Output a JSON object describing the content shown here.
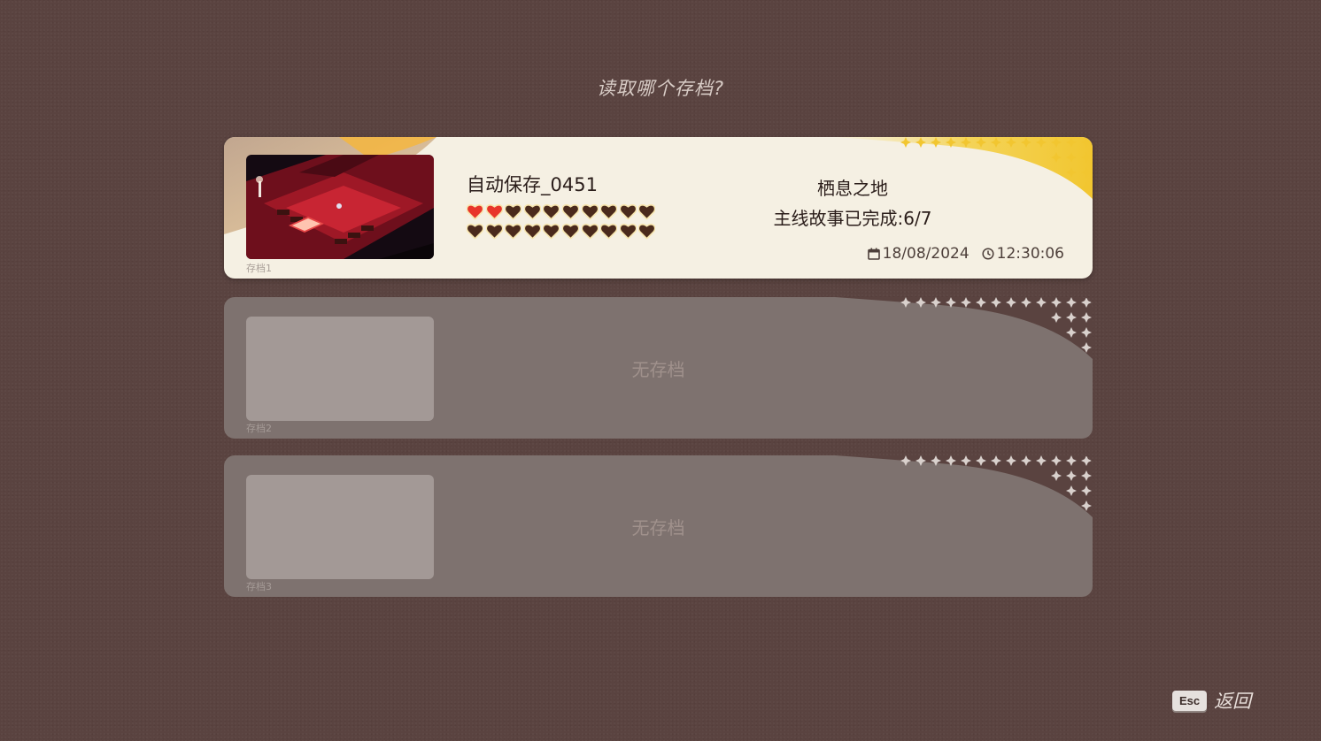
{
  "title": "读取哪个存档?",
  "slots": [
    {
      "label": "存档1",
      "filled": true,
      "save_name": "自动保存_0451",
      "hearts_filled": 2,
      "hearts_total": 20,
      "location": "栖息之地",
      "progress": "主线故事已完成:6/7",
      "date": "18/08/2024",
      "time": "12:30:06"
    },
    {
      "label": "存档2",
      "filled": false,
      "empty_text": "无存档"
    },
    {
      "label": "存档3",
      "filled": false,
      "empty_text": "无存档"
    }
  ],
  "footer": {
    "key": "Esc",
    "action": "返回"
  },
  "colors": {
    "background": "#5a4340",
    "card_filled": "#f5f0e3",
    "card_empty": "#7e726f",
    "heart_full": "#e8352a",
    "heart_empty": "#4a2a1c",
    "accent_gold": "#f2cc3a"
  },
  "icons": {
    "calendar": "calendar-icon",
    "clock": "clock-icon",
    "heart": "heart-icon",
    "sparkle": "sparkle-icon"
  }
}
